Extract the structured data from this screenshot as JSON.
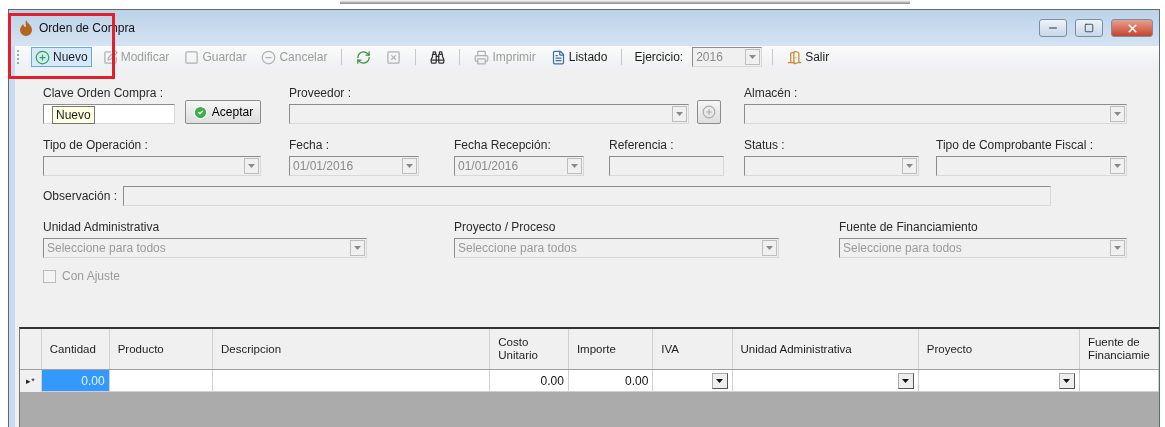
{
  "window": {
    "title": "Orden de Compra"
  },
  "toolbar": [
    {
      "kind": "grip"
    },
    {
      "kind": "button",
      "label": "Nuevo",
      "disabled": false,
      "highlighted": true
    },
    {
      "kind": "button",
      "label": "Modificar",
      "disabled": true,
      "highlighted": false
    },
    {
      "kind": "button",
      "label": "Guardar",
      "disabled": true,
      "highlighted": false
    },
    {
      "kind": "button",
      "label": "Cancelar",
      "disabled": true,
      "highlighted": false
    },
    {
      "kind": "separator"
    },
    {
      "kind": "icon_button",
      "disabled": false,
      "highlighted": false
    },
    {
      "kind": "icon_button",
      "disabled": true,
      "highlighted": false
    },
    {
      "kind": "separator"
    },
    {
      "kind": "icon_button",
      "disabled": false,
      "highlighted": false
    },
    {
      "kind": "separator"
    },
    {
      "kind": "button",
      "label": "Imprimir",
      "disabled": true,
      "highlighted": false
    },
    {
      "kind": "button",
      "label": "Listado",
      "disabled": false,
      "highlighted": false
    },
    {
      "kind": "separator"
    },
    {
      "kind": "label",
      "label": "Ejercicio:"
    },
    {
      "kind": "combo",
      "value": "2016",
      "disabled": true
    },
    {
      "kind": "separator"
    },
    {
      "kind": "button",
      "label": "Salir",
      "disabled": false,
      "highlighted": false
    }
  ],
  "tooltip": {
    "text": "Nuevo"
  },
  "form": {
    "row_1": [
      {
        "kind": "text",
        "label": "Clave Orden Compra :",
        "disabled": false
      },
      {
        "kind": "button",
        "label": "Aceptar"
      },
      {
        "kind": "combo",
        "label": "Proveedor :",
        "disabled": true
      },
      {
        "kind": "icon_button",
        "disabled": true
      },
      {
        "kind": "combo",
        "label": "Almacén :",
        "disabled": true
      }
    ],
    "row_2": [
      {
        "kind": "combo",
        "label": "Tipo de Operación :",
        "disabled": true
      },
      {
        "kind": "combo",
        "label": "Fecha :",
        "value": "01/01/2016",
        "disabled": true
      },
      {
        "kind": "combo",
        "label": "Fecha Recepción:",
        "value": "01/01/2016",
        "disabled": true
      },
      {
        "kind": "text",
        "label": "Referencia :",
        "disabled": true
      },
      {
        "kind": "combo",
        "label": "Status :",
        "disabled": true
      },
      {
        "kind": "combo",
        "label": "Tipo de Comprobante Fiscal :",
        "disabled": true
      }
    ],
    "observacion": {
      "label": "Observación :",
      "disabled": true
    },
    "row_3": [
      {
        "kind": "combo",
        "label": "Unidad Administrativa",
        "placeholder": "Seleccione para todos",
        "disabled": true
      },
      {
        "kind": "combo",
        "label": "Proyecto / Proceso",
        "placeholder": "Seleccione para todos",
        "disabled": true
      },
      {
        "kind": "combo",
        "label": "Fuente de Financiamiento",
        "placeholder": "Seleccione para todos",
        "disabled": true
      }
    ],
    "con_ajuste": {
      "label": "Con Ajuste",
      "checked": false,
      "disabled": true
    }
  },
  "grid": {
    "columns": [
      "Cantidad",
      "Producto",
      "Descripcion",
      "Costo Unitario",
      "Importe",
      "IVA",
      "Unidad Administrativa",
      "Proyecto",
      "Fuente de Financiamie"
    ],
    "rows": [
      {
        "marker": "▸*",
        "cells": [
          {
            "kind": "text",
            "value": "0.00",
            "selected": true
          },
          {
            "kind": "text",
            "selected": false
          },
          {
            "kind": "text",
            "selected": false
          },
          {
            "kind": "text",
            "value": "0.00",
            "selected": false
          },
          {
            "kind": "text",
            "value": "0.00",
            "selected": false
          },
          {
            "kind": "combo",
            "selected": false
          },
          {
            "kind": "combo",
            "selected": false
          },
          {
            "kind": "combo",
            "selected": false
          },
          {
            "kind": "text",
            "selected": false
          }
        ]
      }
    ]
  }
}
